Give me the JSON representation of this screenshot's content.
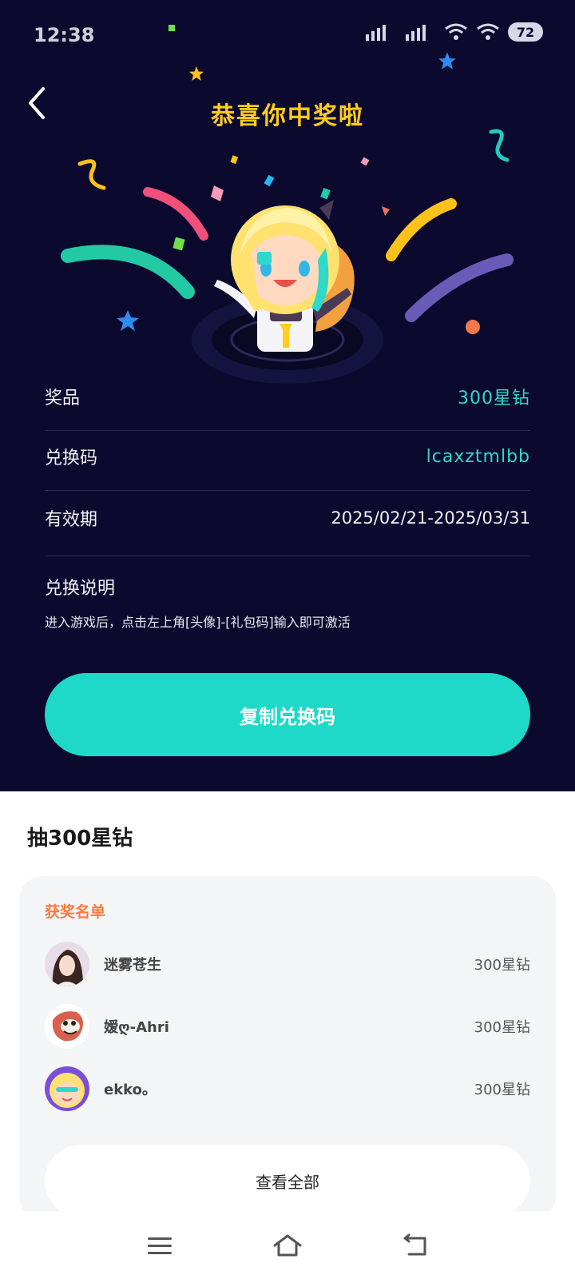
{
  "status_bar": {
    "time": "12:38",
    "battery": "72"
  },
  "header": {
    "title": "恭喜你中奖啦"
  },
  "prize_info": {
    "prize_label": "奖品",
    "prize_value": "300星钻",
    "code_label": "兑换码",
    "code_value": "lcaxztmlbb",
    "validity_label": "有效期",
    "validity_value": "2025/02/21-2025/03/31",
    "explain_title": "兑换说明",
    "explain_text": "进入游戏后，点击左上角[头像]-[礼包码]输入即可激活"
  },
  "copy_button": {
    "label": "复制兑换码"
  },
  "lottery": {
    "section_title": "抽300星钻",
    "winners_title": "获奖名单",
    "winners": [
      {
        "name": "迷雾苍生",
        "prize": "300星钻"
      },
      {
        "name": "嫒ღ-Ahri",
        "prize": "300星钻"
      },
      {
        "name": "ekko。",
        "prize": "300星钻"
      }
    ],
    "view_all_label": "查看全部"
  },
  "colors": {
    "background": "#0b0a2e",
    "accent_teal": "#1ed8c8",
    "title_yellow": "#ffcc1f",
    "orange": "#ff7a3d"
  }
}
